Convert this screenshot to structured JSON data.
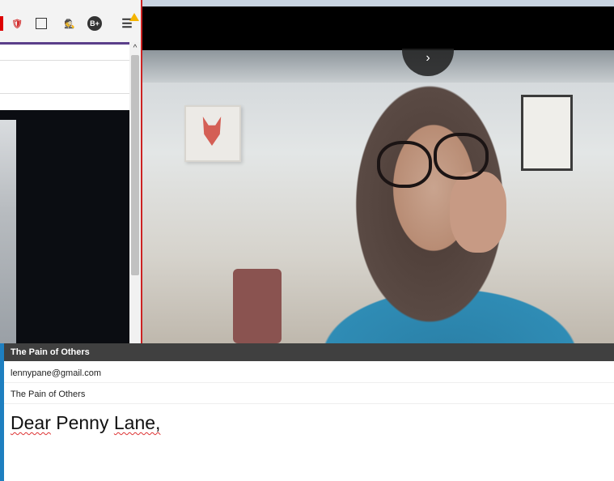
{
  "browser": {
    "toolbar_icons": [
      {
        "name": "ublock-icon",
        "glyph": "🛡"
      },
      {
        "name": "reader-view-icon",
        "glyph": "▯"
      },
      {
        "name": "spy-extension-icon",
        "glyph": "🕵"
      },
      {
        "name": "b-plus-extension-icon",
        "glyph": "B+"
      },
      {
        "name": "menu-icon",
        "glyph": "☰"
      }
    ],
    "scroll_up_glyph": "^"
  },
  "video": {
    "next_glyph": "›"
  },
  "compose": {
    "title": "The Pain of Others",
    "to": "lennypane@gmail.com",
    "subject": "The Pain of Others",
    "body_greeting_word": "Dear",
    "body_name_first": "Penny",
    "body_name_last": "Lane,"
  },
  "colors": {
    "accent_purple": "#5b3f8a",
    "header_dark": "#404040",
    "window_border_red": "#cc2222"
  }
}
